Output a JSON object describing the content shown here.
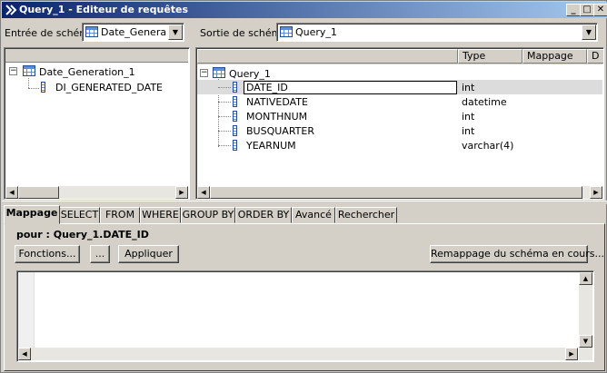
{
  "window": {
    "title": "Query_1 - Editeur de requêtes",
    "controls": {
      "minimize": "_",
      "maximize": "□",
      "close": "✕"
    }
  },
  "input_schema": {
    "label": "Entrée de schéma :",
    "selected": "Date_Generation",
    "tree": {
      "root": "Date_Generation_1",
      "children": [
        "DI_GENERATED_DATE"
      ]
    }
  },
  "output_schema": {
    "label": "Sortie de schéma :",
    "selected": "Query_1",
    "columns": [
      "Type",
      "Mappage",
      "D"
    ],
    "tree": {
      "root": "Query_1",
      "rows": [
        {
          "name": "DATE_ID",
          "type": "int"
        },
        {
          "name": "NATIVEDATE",
          "type": "datetime"
        },
        {
          "name": "MONTHNUM",
          "type": "int"
        },
        {
          "name": "BUSQUARTER",
          "type": "int"
        },
        {
          "name": "YEARNUM",
          "type": "varchar(4)"
        }
      ]
    }
  },
  "tabs": [
    "Mappage",
    "SELECT",
    "FROM",
    "WHERE",
    "GROUP BY",
    "ORDER BY",
    "Avancé",
    "Rechercher"
  ],
  "mapping": {
    "for_label": "pour : Query_1.DATE_ID",
    "functions_button": "Fonctions...",
    "ellipsis_button": "...",
    "apply_button": "Appliquer",
    "remap_button": "Remappage du schéma en cours..."
  }
}
